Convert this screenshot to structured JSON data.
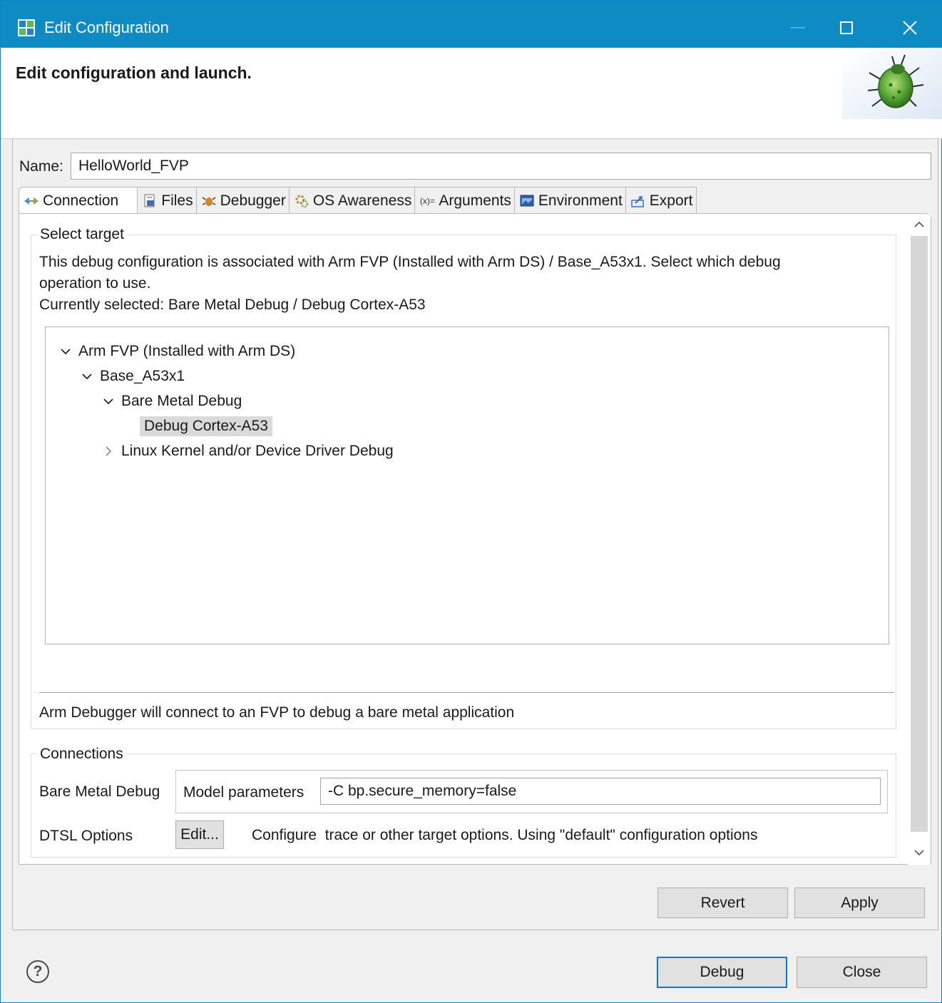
{
  "window": {
    "title": "Edit Configuration",
    "heading": "Edit configuration and launch."
  },
  "name": {
    "label": "Name:",
    "value": "HelloWorld_FVP"
  },
  "tabs": [
    {
      "label": "Connection",
      "icon": "connection-icon",
      "active": true
    },
    {
      "label": "Files",
      "icon": "files-icon"
    },
    {
      "label": "Debugger",
      "icon": "debugger-icon"
    },
    {
      "label": "OS Awareness",
      "icon": "os-awareness-icon"
    },
    {
      "label": "Arguments",
      "icon": "arguments-icon"
    },
    {
      "label": "Environment",
      "icon": "environment-icon"
    },
    {
      "label": "Export",
      "icon": "export-icon"
    }
  ],
  "select_target": {
    "title": "Select target",
    "desc_line1": "This debug configuration is associated with Arm FVP (Installed with Arm DS) / Base_A53x1. Select which debug",
    "desc_line2": "operation to use.",
    "desc_line3": "Currently selected: Bare Metal Debug / Debug Cortex-A53",
    "tree": [
      {
        "label": "Arm FVP (Installed with Arm DS)",
        "expanded": true
      },
      {
        "label": "Base_A53x1",
        "expanded": true
      },
      {
        "label": "Bare Metal Debug",
        "expanded": true
      },
      {
        "label": "Debug Cortex-A53",
        "selected": true
      },
      {
        "label": "Linux Kernel and/or Device Driver Debug",
        "expanded": false
      }
    ],
    "status": "Arm Debugger will connect to an FVP to debug a bare metal application"
  },
  "connections": {
    "title": "Connections",
    "bare_metal_label": "Bare Metal Debug",
    "model_params_label": "Model parameters",
    "model_params_value": "-C bp.secure_memory=false",
    "dtsl_label": "DTSL Options",
    "edit_button": "Edit...",
    "dtsl_desc": "Configure  trace or other target options. Using \"default\" configuration options"
  },
  "buttons": {
    "revert": "Revert",
    "apply": "Apply",
    "debug": "Debug",
    "close": "Close",
    "help": "?"
  },
  "colors": {
    "titlebar": "#0e8bc3",
    "accent": "#0078d7"
  }
}
